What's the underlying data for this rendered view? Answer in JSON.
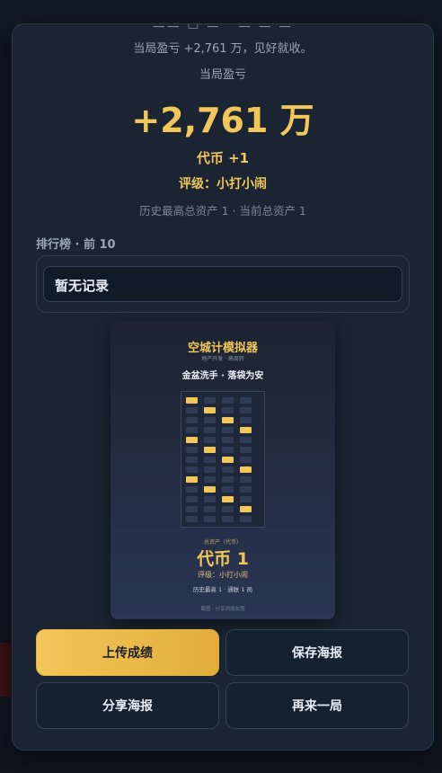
{
  "modal": {
    "top_cut_text": "三三 □ 三 · 三 三 三",
    "subtitle": "当局盈亏 +2,761 万，见好就收。",
    "pnl_label": "当局盈亏",
    "pnl_value": "+2,761 万",
    "coin_text": "代币 +1",
    "grade_text": "评级：小打小闹",
    "history_text": "历史最高总资产 1 · 当前总资产 1"
  },
  "leaderboard": {
    "title": "排行榜 · 前 10",
    "empty_text": "暂无记录"
  },
  "poster": {
    "title": "空城计模拟器",
    "subtitle": "地产开发 · 高周转",
    "slogan": "金盆洗手 · 落袋为安",
    "grid": {
      "columns": 4,
      "rows": 13,
      "lit": [
        [
          0,
          0
        ],
        [
          1,
          1
        ],
        [
          2,
          2
        ],
        [
          3,
          3
        ],
        [
          0,
          4
        ],
        [
          1,
          5
        ],
        [
          2,
          6
        ],
        [
          3,
          7
        ],
        [
          0,
          8
        ],
        [
          1,
          9
        ],
        [
          2,
          10
        ],
        [
          3,
          11
        ]
      ]
    },
    "asset_label": "总资产（代币）",
    "coin_value": "代币 1",
    "grade": "评级：小打小闹",
    "history": "历史最高 1 · 通胀 1 局",
    "footer": "截图 · 分享到朋友圈"
  },
  "buttons": {
    "upload": "上传成绩",
    "save_poster": "保存海报",
    "share_poster": "分享海报",
    "play_again": "再来一局"
  },
  "colors": {
    "accent": "#f2c659",
    "modal_bg": "#1a2432",
    "page_bg": "#0f1620"
  }
}
